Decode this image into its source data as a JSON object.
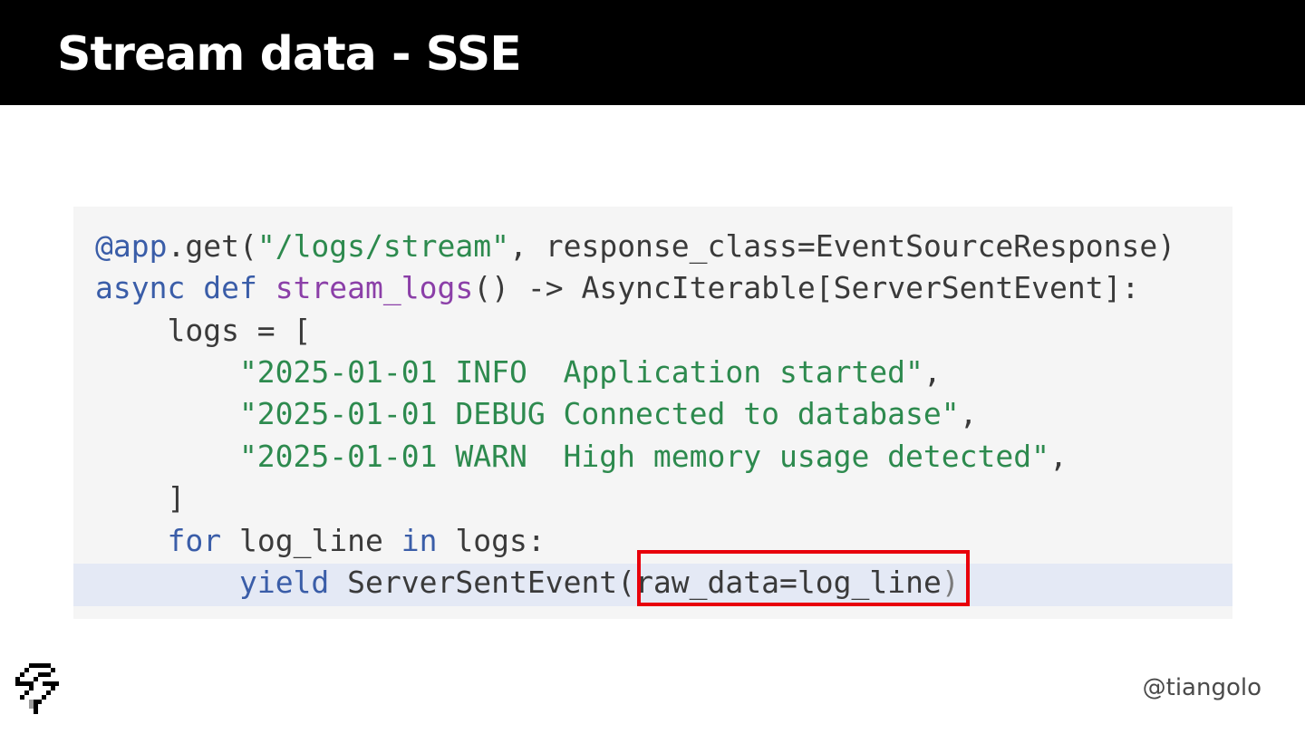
{
  "slide": {
    "title": "Stream data - SSE",
    "footer_handle": "@tiangolo",
    "accent_color": "#e8000b"
  },
  "code": {
    "decorator_name": "@app",
    "decorator_call": ".get(",
    "decorator_path": "\"/logs/stream\"",
    "decorator_rest": ", response_class=EventSourceResponse)",
    "kw_async": "async",
    "kw_def": "def",
    "func_name": "stream_logs",
    "func_sig": "() -> AsyncIterable[ServerSentEvent]:",
    "logs_open": "    logs = [",
    "log_1": "        \"2025-01-01 INFO  Application started\"",
    "log_2": "        \"2025-01-01 DEBUG Connected to database\"",
    "log_3": "        \"2025-01-01 WARN  High memory usage detected\"",
    "comma": ",",
    "logs_close": "    ]",
    "kw_for": "for",
    "for_var": " log_line ",
    "kw_in": "in",
    "for_rest": " logs:",
    "kw_yield": "yield",
    "yield_call": " ServerSentEvent(",
    "yield_arg": "raw_data=log_line",
    "yield_close": ")",
    "highlighted_arg": "raw_data=log_line"
  }
}
